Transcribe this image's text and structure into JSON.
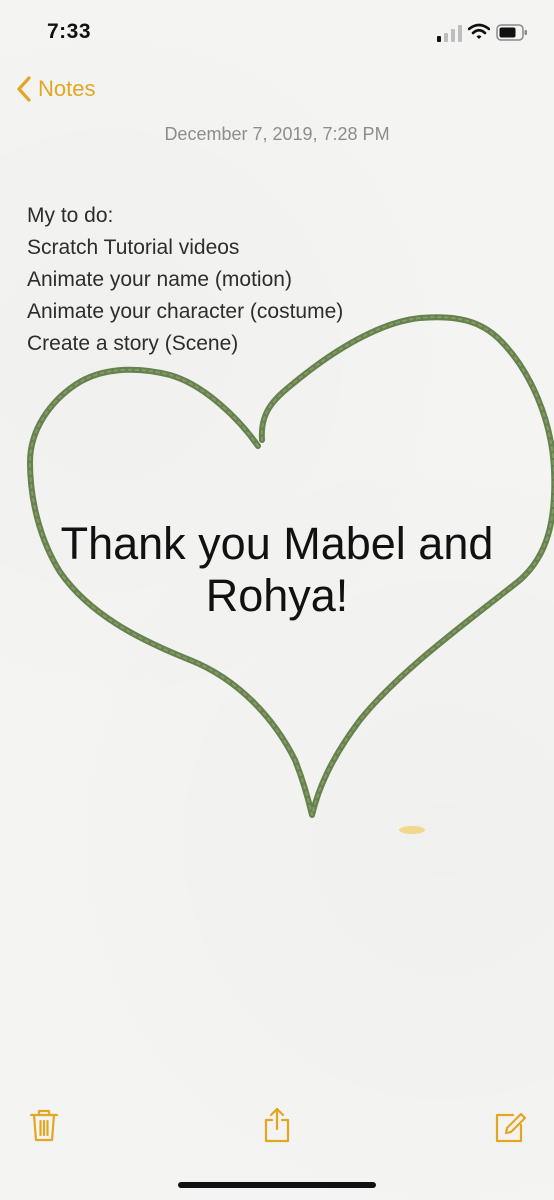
{
  "status_bar": {
    "time": "7:33",
    "signal_icon": "cellular-signal-icon",
    "wifi_icon": "wifi-icon",
    "battery_icon": "battery-icon"
  },
  "nav": {
    "back_label": "Notes",
    "back_icon": "chevron-left-icon"
  },
  "note": {
    "date": "December 7, 2019, 7:28 PM",
    "lines": [
      "My to do:",
      "Scratch Tutorial videos",
      "Animate your name (motion)",
      "Animate your character (costume)",
      "Create a story (Scene)"
    ],
    "handwritten": {
      "line1": "Thank you Mabel and",
      "line2": "Rohya!"
    }
  },
  "toolbar": {
    "delete_icon": "trash-icon",
    "share_icon": "share-icon",
    "compose_icon": "compose-icon"
  },
  "colors": {
    "accent": "#e3a622",
    "drawing_stroke": "#5e7a45",
    "background": "#f4f4f2"
  }
}
